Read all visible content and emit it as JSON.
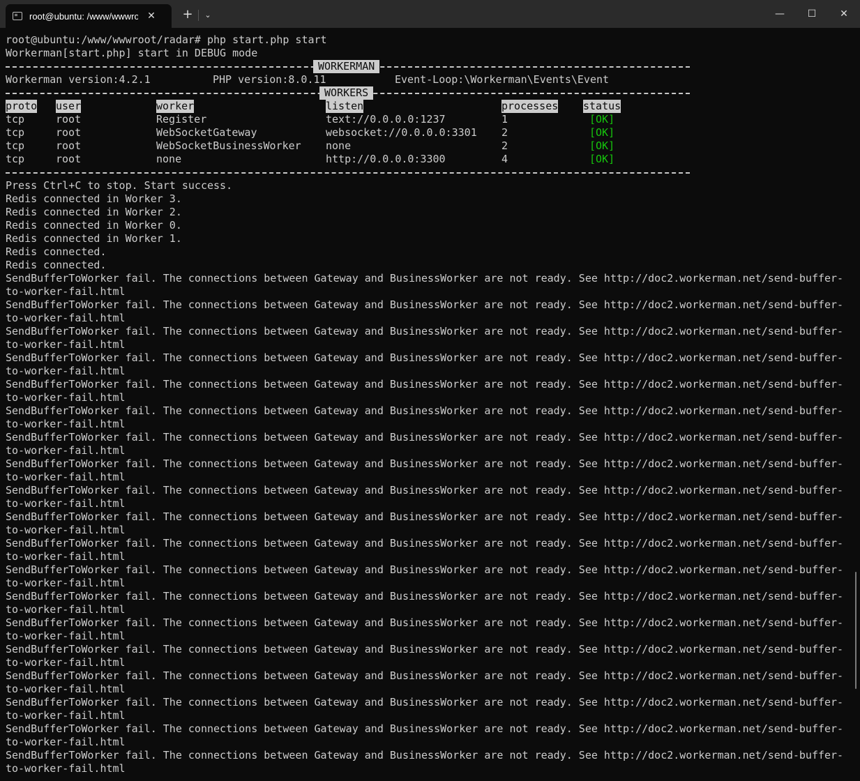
{
  "window": {
    "tab_title": "root@ubuntu: /www/wwwroot/radar",
    "tab_icon": "terminal-icon",
    "close_tab_glyph": "✕",
    "new_tab_glyph": "+",
    "dropdown_glyph": "⌄",
    "minimize_glyph": "—",
    "maximize_glyph": "☐",
    "close_glyph": "✕"
  },
  "terminal": {
    "prompt_line": "root@ubuntu:/www/wwwroot/radar# php start.php start",
    "mode_line": "Workerman[start.php] start in DEBUG mode",
    "workerman_label": "WORKERMAN",
    "workers_label": "WORKERS",
    "version_info": {
      "workerman": "Workerman version:4.2.1",
      "php": "PHP version:8.0.11",
      "event_loop": "Event-Loop:\\Workerman\\Events\\Event"
    },
    "table_headers": {
      "proto": "proto",
      "user": "user",
      "worker": "worker",
      "listen": "listen",
      "processes": "processes",
      "status": "status"
    },
    "workers": [
      {
        "proto": "tcp",
        "user": "root",
        "worker": "Register",
        "listen": "text://0.0.0.0:1237",
        "processes": "1",
        "status": "[OK]"
      },
      {
        "proto": "tcp",
        "user": "root",
        "worker": "WebSocketGateway",
        "listen": "websocket://0.0.0.0:3301",
        "processes": "2",
        "status": "[OK]"
      },
      {
        "proto": "tcp",
        "user": "root",
        "worker": "WebSocketBusinessWorker",
        "listen": "none",
        "processes": "2",
        "status": "[OK]"
      },
      {
        "proto": "tcp",
        "user": "root",
        "worker": "none",
        "listen": "http://0.0.0.0:3300",
        "processes": "4",
        "status": "[OK]"
      }
    ],
    "log_lines": [
      "Press Ctrl+C to stop. Start success.",
      "Redis connected in Worker 3.",
      "Redis connected in Worker 2.",
      "Redis connected in Worker 0.",
      "Redis connected in Worker 1.",
      "Redis connected.",
      "Redis connected."
    ],
    "error_line_1": "SendBufferToWorker fail. The connections between Gateway and BusinessWorker are not ready. See http://doc2.workerman.net/send-buffer-",
    "error_line_2": "to-worker-fail.html",
    "error_repeat_count": 19
  }
}
